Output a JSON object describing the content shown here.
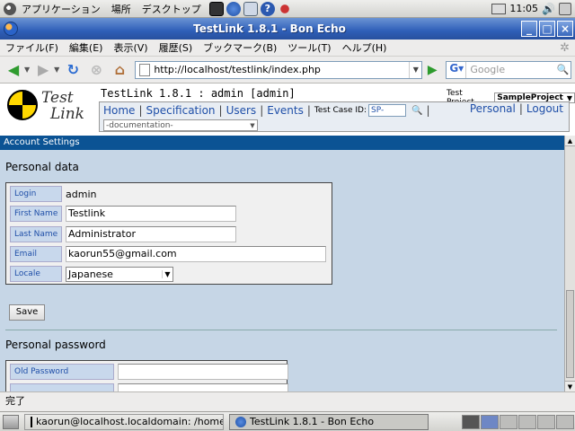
{
  "top_panel": {
    "menus": [
      "アプリケーション",
      "場所",
      "デスクトップ"
    ],
    "clock": "11:05"
  },
  "window": {
    "title": "TestLink 1.8.1 - Bon Echo",
    "buttons": [
      "_",
      "□",
      "×"
    ]
  },
  "menubar": {
    "items": [
      "ファイル(F)",
      "編集(E)",
      "表示(V)",
      "履歴(S)",
      "ブックマーク(B)",
      "ツール(T)",
      "ヘルプ(H)"
    ]
  },
  "navbar": {
    "url": "http://localhost/testlink/index.php",
    "search_placeholder": "Google"
  },
  "testlink": {
    "logo_line1": "Test",
    "logo_line2": "Link",
    "title": "TestLink 1.8.1 : admin [admin]",
    "project_label": "Test Project",
    "project_value": "SampleProject",
    "nav_links": [
      "Home",
      "Specification",
      "Users",
      "Events"
    ],
    "tc_id_label": "Test Case ID:",
    "tc_id_value": "SP-",
    "right_links": [
      "Personal",
      "Logout"
    ],
    "doc_select": "-documentation-"
  },
  "account": {
    "bar_title": "Account Settings",
    "personal_data_heading": "Personal data",
    "fields": {
      "login_label": "Login",
      "login_value": "admin",
      "first_name_label": "First Name",
      "first_name_value": "Testlink",
      "last_name_label": "Last Name",
      "last_name_value": "Administrator",
      "email_label": "Email",
      "email_value": "kaorun55@gmail.com",
      "locale_label": "Locale",
      "locale_value": "Japanese"
    },
    "save_label": "Save",
    "password_heading": "Personal password",
    "old_password_label": "Old Password"
  },
  "status": {
    "text": "完了"
  },
  "taskbar": {
    "tasks": [
      "kaorun@localhost.localdomain: /home···",
      "TestLink 1.8.1 - Bon Echo"
    ]
  }
}
